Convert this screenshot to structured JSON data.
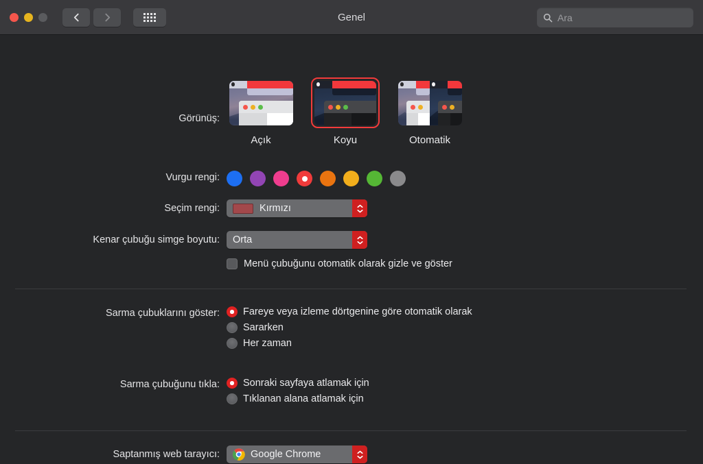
{
  "window": {
    "title": "Genel",
    "traffic_lights": [
      "close",
      "minimize",
      "zoom"
    ],
    "nav": {
      "back_icon": "chevron-left-icon",
      "forward_icon": "chevron-right-icon",
      "grid_icon": "grid-of-dots-icon"
    },
    "search": {
      "placeholder": "Ara",
      "icon": "search-icon"
    }
  },
  "appearance": {
    "label": "Görünüş:",
    "options": [
      {
        "id": "light",
        "name": "Açık",
        "selected": false
      },
      {
        "id": "dark",
        "name": "Koyu",
        "selected": true
      },
      {
        "id": "auto",
        "name": "Otomatik",
        "selected": false
      }
    ]
  },
  "accent": {
    "label": "Vurgu rengi:",
    "swatches": [
      {
        "name": "blue",
        "color": "#1d6ff2",
        "selected": false
      },
      {
        "name": "purple",
        "color": "#9245b4",
        "selected": false
      },
      {
        "name": "pink",
        "color": "#ef3d8e",
        "selected": false
      },
      {
        "name": "red",
        "color": "#f03b3b",
        "selected": true
      },
      {
        "name": "orange",
        "color": "#ea7410",
        "selected": false
      },
      {
        "name": "yellow",
        "color": "#f2ae1c",
        "selected": false
      },
      {
        "name": "green",
        "color": "#55b735",
        "selected": false
      },
      {
        "name": "graphite",
        "color": "#8a8a8c",
        "selected": false
      }
    ]
  },
  "highlight": {
    "label": "Seçim rengi:",
    "value": "Kırmızı",
    "swatch_color": "#a2484b",
    "stepper_icon": "stepper-up-down-icon"
  },
  "sidebar_icon_size": {
    "label": "Kenar çubuğu simge boyutu:",
    "value": "Orta",
    "stepper_icon": "stepper-up-down-icon"
  },
  "autohide_menubar": {
    "text": "Menü çubuğunu otomatik olarak gizle ve göster",
    "checked": false
  },
  "show_scrollbars": {
    "label": "Sarma çubuklarını göster:",
    "options": [
      {
        "text": "Fareye veya izleme dörtgenine göre otomatik olarak",
        "selected": true
      },
      {
        "text": "Sararken",
        "selected": false
      },
      {
        "text": "Her zaman",
        "selected": false
      }
    ]
  },
  "click_scrollbar": {
    "label": "Sarma çubuğunu tıkla:",
    "options": [
      {
        "text": "Sonraki sayfaya atlamak için",
        "selected": true
      },
      {
        "text": "Tıklanan alana atlamak için",
        "selected": false
      }
    ]
  },
  "default_browser": {
    "label": "Saptanmış web tarayıcı:",
    "value": "Google Chrome",
    "icon": "chrome-logo-icon",
    "stepper_icon": "stepper-up-down-icon"
  }
}
